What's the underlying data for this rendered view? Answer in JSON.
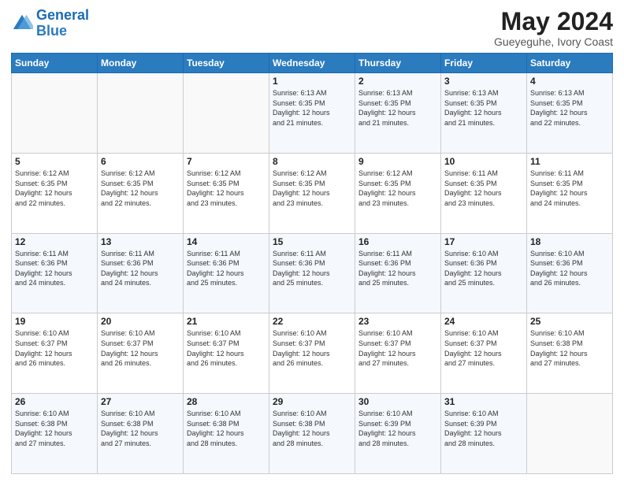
{
  "header": {
    "logo_line1": "General",
    "logo_line2": "Blue",
    "title": "May 2024",
    "subtitle": "Gueyeguhe, Ivory Coast"
  },
  "weekdays": [
    "Sunday",
    "Monday",
    "Tuesday",
    "Wednesday",
    "Thursday",
    "Friday",
    "Saturday"
  ],
  "weeks": [
    [
      {
        "day": "",
        "info": ""
      },
      {
        "day": "",
        "info": ""
      },
      {
        "day": "",
        "info": ""
      },
      {
        "day": "1",
        "info": "Sunrise: 6:13 AM\nSunset: 6:35 PM\nDaylight: 12 hours\nand 21 minutes."
      },
      {
        "day": "2",
        "info": "Sunrise: 6:13 AM\nSunset: 6:35 PM\nDaylight: 12 hours\nand 21 minutes."
      },
      {
        "day": "3",
        "info": "Sunrise: 6:13 AM\nSunset: 6:35 PM\nDaylight: 12 hours\nand 21 minutes."
      },
      {
        "day": "4",
        "info": "Sunrise: 6:13 AM\nSunset: 6:35 PM\nDaylight: 12 hours\nand 22 minutes."
      }
    ],
    [
      {
        "day": "5",
        "info": "Sunrise: 6:12 AM\nSunset: 6:35 PM\nDaylight: 12 hours\nand 22 minutes."
      },
      {
        "day": "6",
        "info": "Sunrise: 6:12 AM\nSunset: 6:35 PM\nDaylight: 12 hours\nand 22 minutes."
      },
      {
        "day": "7",
        "info": "Sunrise: 6:12 AM\nSunset: 6:35 PM\nDaylight: 12 hours\nand 23 minutes."
      },
      {
        "day": "8",
        "info": "Sunrise: 6:12 AM\nSunset: 6:35 PM\nDaylight: 12 hours\nand 23 minutes."
      },
      {
        "day": "9",
        "info": "Sunrise: 6:12 AM\nSunset: 6:35 PM\nDaylight: 12 hours\nand 23 minutes."
      },
      {
        "day": "10",
        "info": "Sunrise: 6:11 AM\nSunset: 6:35 PM\nDaylight: 12 hours\nand 23 minutes."
      },
      {
        "day": "11",
        "info": "Sunrise: 6:11 AM\nSunset: 6:35 PM\nDaylight: 12 hours\nand 24 minutes."
      }
    ],
    [
      {
        "day": "12",
        "info": "Sunrise: 6:11 AM\nSunset: 6:36 PM\nDaylight: 12 hours\nand 24 minutes."
      },
      {
        "day": "13",
        "info": "Sunrise: 6:11 AM\nSunset: 6:36 PM\nDaylight: 12 hours\nand 24 minutes."
      },
      {
        "day": "14",
        "info": "Sunrise: 6:11 AM\nSunset: 6:36 PM\nDaylight: 12 hours\nand 25 minutes."
      },
      {
        "day": "15",
        "info": "Sunrise: 6:11 AM\nSunset: 6:36 PM\nDaylight: 12 hours\nand 25 minutes."
      },
      {
        "day": "16",
        "info": "Sunrise: 6:11 AM\nSunset: 6:36 PM\nDaylight: 12 hours\nand 25 minutes."
      },
      {
        "day": "17",
        "info": "Sunrise: 6:10 AM\nSunset: 6:36 PM\nDaylight: 12 hours\nand 25 minutes."
      },
      {
        "day": "18",
        "info": "Sunrise: 6:10 AM\nSunset: 6:36 PM\nDaylight: 12 hours\nand 26 minutes."
      }
    ],
    [
      {
        "day": "19",
        "info": "Sunrise: 6:10 AM\nSunset: 6:37 PM\nDaylight: 12 hours\nand 26 minutes."
      },
      {
        "day": "20",
        "info": "Sunrise: 6:10 AM\nSunset: 6:37 PM\nDaylight: 12 hours\nand 26 minutes."
      },
      {
        "day": "21",
        "info": "Sunrise: 6:10 AM\nSunset: 6:37 PM\nDaylight: 12 hours\nand 26 minutes."
      },
      {
        "day": "22",
        "info": "Sunrise: 6:10 AM\nSunset: 6:37 PM\nDaylight: 12 hours\nand 26 minutes."
      },
      {
        "day": "23",
        "info": "Sunrise: 6:10 AM\nSunset: 6:37 PM\nDaylight: 12 hours\nand 27 minutes."
      },
      {
        "day": "24",
        "info": "Sunrise: 6:10 AM\nSunset: 6:37 PM\nDaylight: 12 hours\nand 27 minutes."
      },
      {
        "day": "25",
        "info": "Sunrise: 6:10 AM\nSunset: 6:38 PM\nDaylight: 12 hours\nand 27 minutes."
      }
    ],
    [
      {
        "day": "26",
        "info": "Sunrise: 6:10 AM\nSunset: 6:38 PM\nDaylight: 12 hours\nand 27 minutes."
      },
      {
        "day": "27",
        "info": "Sunrise: 6:10 AM\nSunset: 6:38 PM\nDaylight: 12 hours\nand 27 minutes."
      },
      {
        "day": "28",
        "info": "Sunrise: 6:10 AM\nSunset: 6:38 PM\nDaylight: 12 hours\nand 28 minutes."
      },
      {
        "day": "29",
        "info": "Sunrise: 6:10 AM\nSunset: 6:38 PM\nDaylight: 12 hours\nand 28 minutes."
      },
      {
        "day": "30",
        "info": "Sunrise: 6:10 AM\nSunset: 6:39 PM\nDaylight: 12 hours\nand 28 minutes."
      },
      {
        "day": "31",
        "info": "Sunrise: 6:10 AM\nSunset: 6:39 PM\nDaylight: 12 hours\nand 28 minutes."
      },
      {
        "day": "",
        "info": ""
      }
    ]
  ]
}
